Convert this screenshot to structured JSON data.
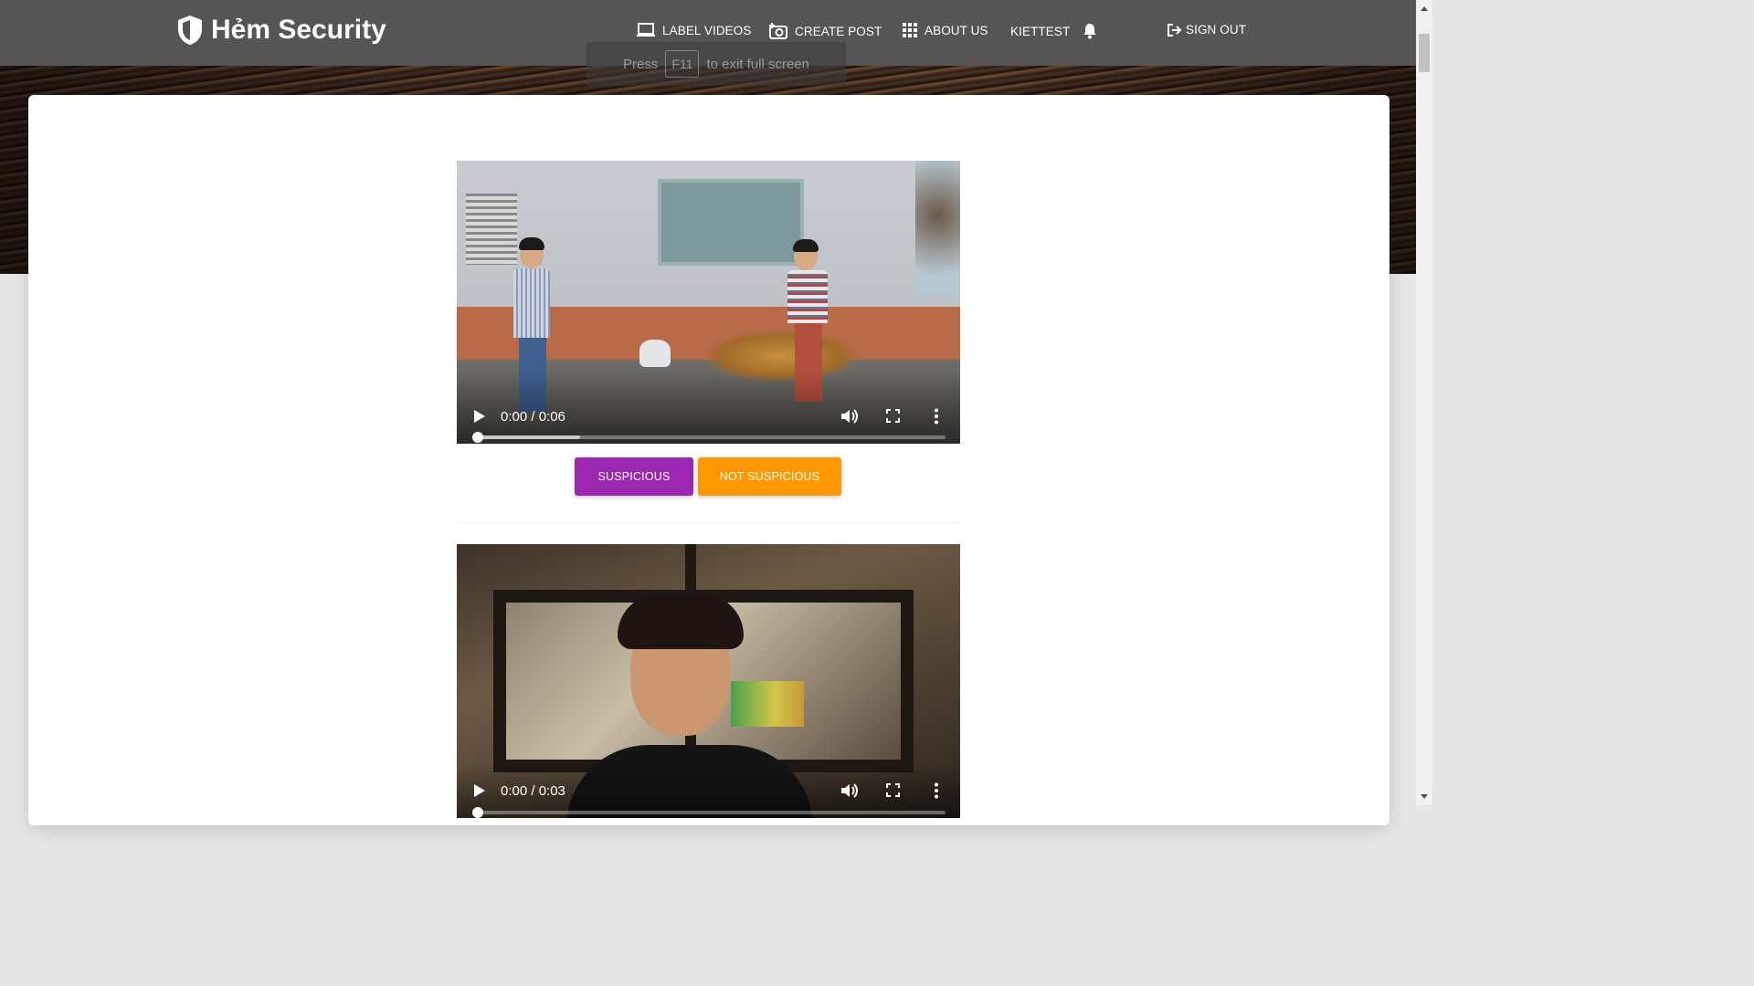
{
  "brand": {
    "name": "Hẻm Security",
    "icon": "shield-icon"
  },
  "nav": {
    "label_videos": "LABEL VIDEOS",
    "create_post": "CREATE POST",
    "about_us": "ABOUT US",
    "username": "KIETTEST",
    "sign_out": "SIGN OUT"
  },
  "fullscreen_toast": {
    "before": "Press",
    "key": "F11",
    "after": "to exit full screen"
  },
  "videos": [
    {
      "time": "0:00 / 0:06",
      "buffered_fraction": 0.22,
      "progress_fraction": 0.0
    },
    {
      "time": "0:00 / 0:03",
      "buffered_fraction": 0.0,
      "progress_fraction": 0.0
    }
  ],
  "actions": {
    "suspicious": "SUSPICIOUS",
    "not_suspicious": "NOT SUSPICIOUS"
  },
  "colors": {
    "navbar": "#555555",
    "suspicious": "#9c27b0",
    "not_suspicious": "#ff9800"
  }
}
